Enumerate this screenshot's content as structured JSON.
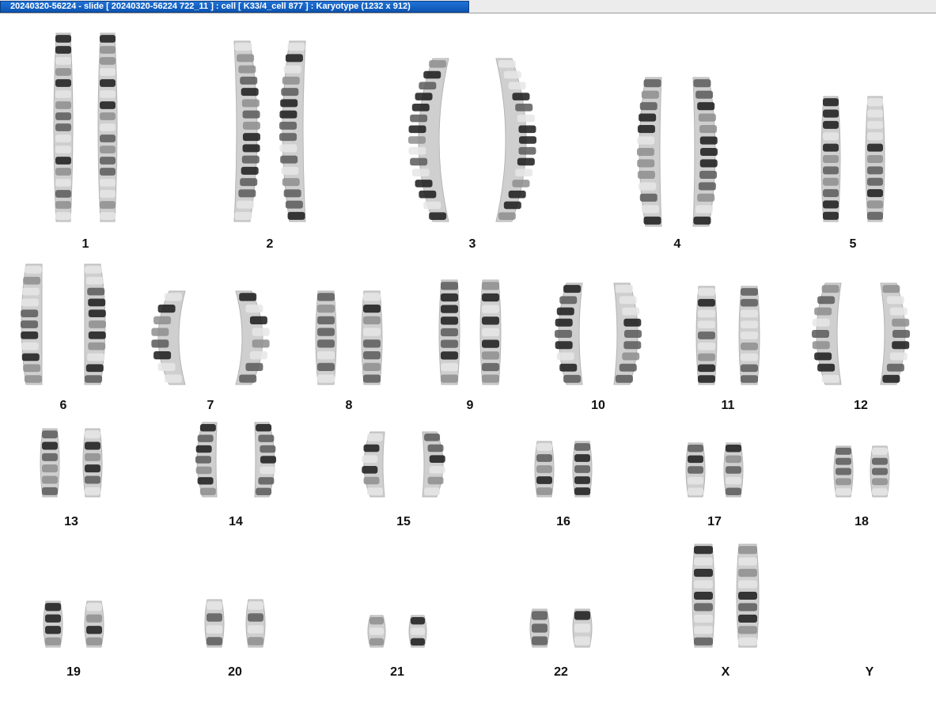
{
  "window": {
    "title": "20240320-56224 - slide [ 20240320-56224 722_11 ] : cell [ K33/4_cell 877 ] : Karyotype  (1232 x 912)"
  },
  "karyotype": {
    "chromosomes": [
      {
        "id": "1",
        "label": "1"
      },
      {
        "id": "2",
        "label": "2"
      },
      {
        "id": "3",
        "label": "3"
      },
      {
        "id": "4",
        "label": "4"
      },
      {
        "id": "5",
        "label": "5"
      },
      {
        "id": "6",
        "label": "6"
      },
      {
        "id": "7",
        "label": "7"
      },
      {
        "id": "8",
        "label": "8"
      },
      {
        "id": "9",
        "label": "9"
      },
      {
        "id": "10",
        "label": "10"
      },
      {
        "id": "11",
        "label": "11"
      },
      {
        "id": "12",
        "label": "12"
      },
      {
        "id": "13",
        "label": "13"
      },
      {
        "id": "14",
        "label": "14"
      },
      {
        "id": "15",
        "label": "15"
      },
      {
        "id": "16",
        "label": "16"
      },
      {
        "id": "17",
        "label": "17"
      },
      {
        "id": "18",
        "label": "18"
      },
      {
        "id": "19",
        "label": "19"
      },
      {
        "id": "20",
        "label": "20"
      },
      {
        "id": "21",
        "label": "21"
      },
      {
        "id": "22",
        "label": "22"
      },
      {
        "id": "X",
        "label": "X"
      },
      {
        "id": "Y",
        "label": "Y"
      }
    ]
  }
}
